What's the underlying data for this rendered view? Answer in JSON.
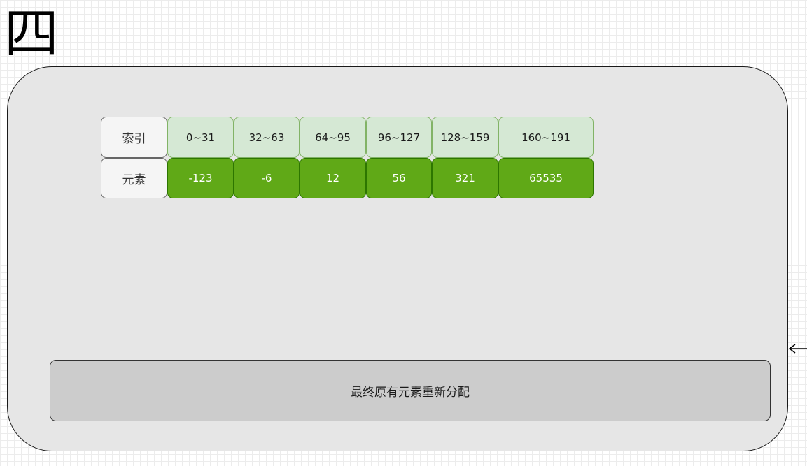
{
  "title": "四",
  "rows": [
    {
      "label": "索引",
      "cells": [
        "0~31",
        "32~63",
        "64~95",
        "96~127",
        "128~159",
        "160~191"
      ]
    },
    {
      "label": "元素",
      "cells": [
        "-123",
        "-6",
        "12",
        "56",
        "321",
        "65535"
      ]
    }
  ],
  "note": "最终原有元素重新分配",
  "colors": {
    "panel_fill": "#e6e6e6",
    "label_fill": "#f5f5f5",
    "index_fill": "#d5e8d4",
    "index_stroke": "#82b366",
    "value_fill": "#60a917",
    "value_stroke": "#2d7600",
    "note_fill": "#cccccc"
  },
  "icons": {
    "connector": "arrow-left-icon"
  }
}
